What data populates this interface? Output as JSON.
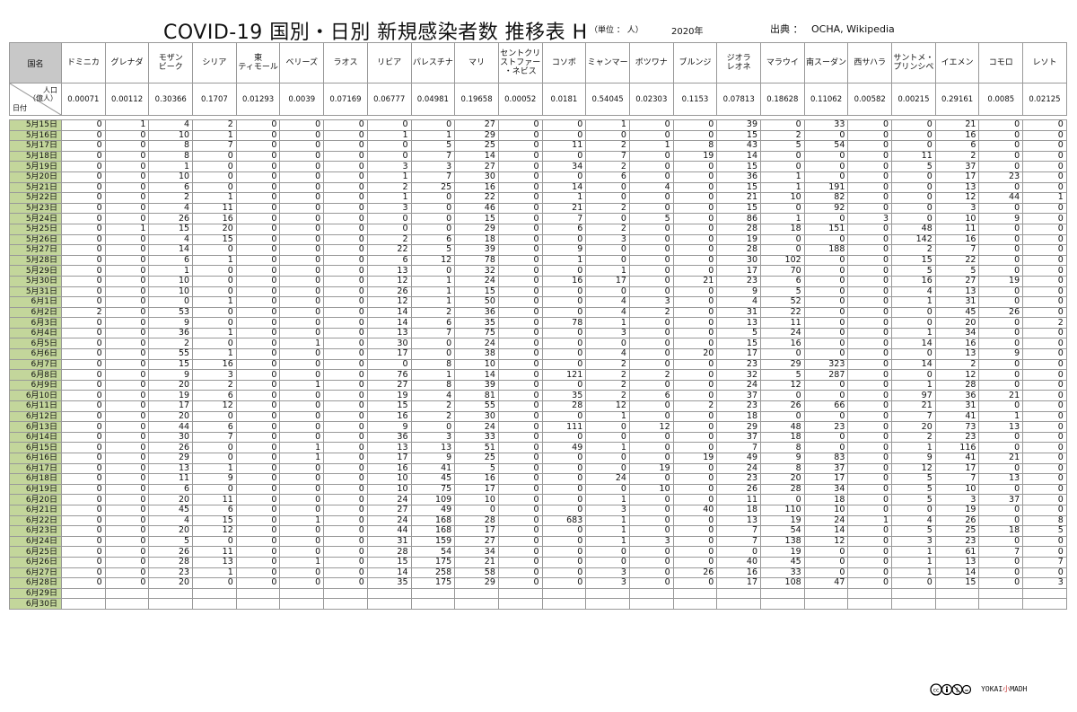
{
  "header": {
    "title": "COVID-19  国別・日別  新規感染者数  推移表  H",
    "unit": "（単位 ： 人）",
    "year": "2020年",
    "source_label": "出典 ：",
    "sources": "OCHA,  Wikipedia"
  },
  "table": {
    "country_label": "国名",
    "population_label": "人口\n（億人）",
    "date_label": "日付",
    "countries": [
      "ドミニカ",
      "グレナダ",
      "モザン\nビーク",
      "シリア",
      "東\nティモール",
      "ベリーズ",
      "ラオス",
      "リビア",
      "パレスチナ",
      "マリ",
      "セントクリ\nストファー\n・ネビス",
      "コソボ",
      "ミャンマー",
      "ボツワナ",
      "ブルンジ",
      "ジオラ\nレオネ",
      "マラウイ",
      "南スーダン",
      "西サハラ",
      "サントメ・\nプリンシペ",
      "イエメン",
      "コモロ",
      "レソト"
    ],
    "population": [
      "0.00071",
      "0.00112",
      "0.30366",
      "0.1707",
      "0.01293",
      "0.0039",
      "0.07169",
      "0.06777",
      "0.04981",
      "0.19658",
      "0.00052",
      "0.0181",
      "0.54045",
      "0.02303",
      "0.1153",
      "0.07813",
      "0.18628",
      "0.11062",
      "0.00582",
      "0.00215",
      "0.29161",
      "0.0085",
      "0.02125"
    ],
    "rows": [
      {
        "date": "5月15日",
        "v": [
          0,
          1,
          4,
          2,
          0,
          0,
          0,
          0,
          0,
          27,
          0,
          0,
          1,
          0,
          0,
          39,
          0,
          33,
          0,
          0,
          21,
          0,
          0
        ]
      },
      {
        "date": "5月16日",
        "v": [
          0,
          0,
          10,
          1,
          0,
          0,
          0,
          1,
          1,
          29,
          0,
          0,
          0,
          0,
          0,
          15,
          2,
          0,
          0,
          0,
          16,
          0,
          0
        ]
      },
      {
        "date": "5月17日",
        "v": [
          0,
          0,
          8,
          7,
          0,
          0,
          0,
          0,
          5,
          25,
          0,
          11,
          2,
          1,
          8,
          43,
          5,
          54,
          0,
          0,
          6,
          0,
          0
        ]
      },
      {
        "date": "5月18日",
        "v": [
          0,
          0,
          8,
          0,
          0,
          0,
          0,
          0,
          7,
          14,
          0,
          0,
          7,
          0,
          19,
          14,
          0,
          0,
          0,
          11,
          2,
          0,
          0
        ]
      },
      {
        "date": "5月19日",
        "v": [
          0,
          0,
          1,
          0,
          0,
          0,
          0,
          3,
          3,
          27,
          0,
          34,
          2,
          0,
          0,
          15,
          0,
          0,
          0,
          5,
          37,
          0,
          0
        ]
      },
      {
        "date": "5月20日",
        "v": [
          0,
          0,
          10,
          0,
          0,
          0,
          0,
          1,
          7,
          30,
          0,
          0,
          6,
          0,
          0,
          36,
          1,
          0,
          0,
          0,
          17,
          23,
          0
        ]
      },
      {
        "date": "5月21日",
        "v": [
          0,
          0,
          6,
          0,
          0,
          0,
          0,
          2,
          25,
          16,
          0,
          14,
          0,
          4,
          0,
          15,
          1,
          191,
          0,
          0,
          13,
          0,
          0
        ]
      },
      {
        "date": "5月22日",
        "v": [
          0,
          0,
          2,
          1,
          0,
          0,
          0,
          1,
          0,
          22,
          0,
          1,
          0,
          0,
          0,
          21,
          10,
          82,
          0,
          0,
          12,
          44,
          1
        ]
      },
      {
        "date": "5月23日",
        "v": [
          0,
          0,
          4,
          11,
          0,
          0,
          0,
          3,
          0,
          46,
          0,
          21,
          2,
          0,
          0,
          15,
          0,
          92,
          0,
          0,
          3,
          0,
          0
        ]
      },
      {
        "date": "5月24日",
        "v": [
          0,
          0,
          26,
          16,
          0,
          0,
          0,
          0,
          0,
          15,
          0,
          7,
          0,
          5,
          0,
          86,
          1,
          0,
          3,
          0,
          10,
          9,
          0
        ]
      },
      {
        "date": "5月25日",
        "v": [
          0,
          1,
          15,
          20,
          0,
          0,
          0,
          0,
          0,
          29,
          0,
          6,
          2,
          0,
          0,
          28,
          18,
          151,
          0,
          48,
          11,
          0,
          0
        ]
      },
      {
        "date": "5月26日",
        "v": [
          0,
          0,
          4,
          15,
          0,
          0,
          0,
          2,
          6,
          18,
          0,
          0,
          3,
          0,
          0,
          19,
          0,
          0,
          0,
          142,
          16,
          0,
          0
        ]
      },
      {
        "date": "5月27日",
        "v": [
          0,
          0,
          14,
          0,
          0,
          0,
          0,
          22,
          5,
          39,
          0,
          9,
          0,
          0,
          0,
          28,
          0,
          188,
          0,
          2,
          7,
          0,
          0
        ]
      },
      {
        "date": "5月28日",
        "v": [
          0,
          0,
          6,
          1,
          0,
          0,
          0,
          6,
          12,
          78,
          0,
          1,
          0,
          0,
          0,
          30,
          102,
          0,
          0,
          15,
          22,
          0,
          0
        ]
      },
      {
        "date": "5月29日",
        "v": [
          0,
          0,
          1,
          0,
          0,
          0,
          0,
          13,
          0,
          32,
          0,
          0,
          1,
          0,
          0,
          17,
          70,
          0,
          0,
          5,
          5,
          0,
          0
        ]
      },
      {
        "date": "5月30日",
        "v": [
          0,
          0,
          10,
          0,
          0,
          0,
          0,
          12,
          1,
          24,
          0,
          16,
          17,
          0,
          21,
          23,
          6,
          0,
          0,
          16,
          27,
          19,
          0
        ]
      },
      {
        "date": "5月31日",
        "v": [
          0,
          0,
          10,
          0,
          0,
          0,
          0,
          26,
          1,
          15,
          0,
          0,
          0,
          0,
          0,
          9,
          5,
          0,
          0,
          4,
          13,
          0,
          0
        ]
      },
      {
        "date": "6月1日",
        "v": [
          0,
          0,
          0,
          1,
          0,
          0,
          0,
          12,
          1,
          50,
          0,
          0,
          4,
          3,
          0,
          4,
          52,
          0,
          0,
          1,
          31,
          0,
          0
        ]
      },
      {
        "date": "6月2日",
        "v": [
          2,
          0,
          53,
          0,
          0,
          0,
          0,
          14,
          2,
          36,
          0,
          0,
          4,
          2,
          0,
          31,
          22,
          0,
          0,
          0,
          45,
          26,
          0
        ]
      },
      {
        "date": "6月3日",
        "v": [
          0,
          0,
          9,
          0,
          0,
          0,
          0,
          14,
          6,
          35,
          0,
          78,
          1,
          0,
          0,
          13,
          11,
          0,
          0,
          0,
          20,
          0,
          2
        ]
      },
      {
        "date": "6月4日",
        "v": [
          0,
          0,
          36,
          1,
          0,
          0,
          0,
          13,
          7,
          75,
          0,
          0,
          3,
          0,
          0,
          5,
          24,
          0,
          0,
          1,
          34,
          0,
          0
        ]
      },
      {
        "date": "6月5日",
        "v": [
          0,
          0,
          2,
          0,
          0,
          1,
          0,
          30,
          0,
          24,
          0,
          0,
          0,
          0,
          0,
          15,
          16,
          0,
          0,
          14,
          16,
          0,
          0
        ]
      },
      {
        "date": "6月6日",
        "v": [
          0,
          0,
          55,
          1,
          0,
          0,
          0,
          17,
          0,
          38,
          0,
          0,
          4,
          0,
          20,
          17,
          0,
          0,
          0,
          0,
          13,
          9,
          0
        ]
      },
      {
        "date": "6月7日",
        "v": [
          0,
          0,
          15,
          16,
          0,
          0,
          0,
          0,
          8,
          10,
          0,
          0,
          2,
          0,
          0,
          23,
          29,
          323,
          0,
          14,
          2,
          0,
          0
        ]
      },
      {
        "date": "6月8日",
        "v": [
          0,
          0,
          9,
          3,
          0,
          0,
          0,
          76,
          1,
          14,
          0,
          121,
          2,
          2,
          0,
          32,
          5,
          287,
          0,
          0,
          12,
          0,
          0
        ]
      },
      {
        "date": "6月9日",
        "v": [
          0,
          0,
          20,
          2,
          0,
          1,
          0,
          27,
          8,
          39,
          0,
          0,
          2,
          0,
          0,
          24,
          12,
          0,
          0,
          1,
          28,
          0,
          0
        ]
      },
      {
        "date": "6月10日",
        "v": [
          0,
          0,
          19,
          6,
          0,
          0,
          0,
          19,
          4,
          81,
          0,
          35,
          2,
          6,
          0,
          37,
          0,
          0,
          0,
          97,
          36,
          21,
          0
        ]
      },
      {
        "date": "6月11日",
        "v": [
          0,
          0,
          17,
          12,
          0,
          0,
          0,
          15,
          2,
          55,
          0,
          28,
          12,
          0,
          2,
          23,
          26,
          66,
          0,
          21,
          31,
          0,
          0
        ]
      },
      {
        "date": "6月12日",
        "v": [
          0,
          0,
          20,
          0,
          0,
          0,
          0,
          16,
          2,
          30,
          0,
          0,
          1,
          0,
          0,
          18,
          0,
          0,
          0,
          7,
          41,
          1,
          0
        ]
      },
      {
        "date": "6月13日",
        "v": [
          0,
          0,
          44,
          6,
          0,
          0,
          0,
          9,
          0,
          24,
          0,
          111,
          0,
          12,
          0,
          29,
          48,
          23,
          0,
          20,
          73,
          13,
          0
        ]
      },
      {
        "date": "6月14日",
        "v": [
          0,
          0,
          30,
          7,
          0,
          0,
          0,
          36,
          3,
          33,
          0,
          0,
          0,
          0,
          0,
          37,
          18,
          0,
          0,
          2,
          23,
          0,
          0
        ]
      },
      {
        "date": "6月15日",
        "v": [
          0,
          0,
          26,
          0,
          0,
          1,
          0,
          13,
          13,
          51,
          0,
          49,
          1,
          0,
          0,
          7,
          8,
          0,
          0,
          1,
          116,
          0,
          0
        ]
      },
      {
        "date": "6月16日",
        "v": [
          0,
          0,
          29,
          0,
          0,
          1,
          0,
          17,
          9,
          25,
          0,
          0,
          0,
          0,
          19,
          49,
          9,
          83,
          0,
          9,
          41,
          21,
          0
        ]
      },
      {
        "date": "6月17日",
        "v": [
          0,
          0,
          13,
          1,
          0,
          0,
          0,
          16,
          41,
          5,
          0,
          0,
          0,
          19,
          0,
          24,
          8,
          37,
          0,
          12,
          17,
          0,
          0
        ]
      },
      {
        "date": "6月18日",
        "v": [
          0,
          0,
          11,
          9,
          0,
          0,
          0,
          10,
          45,
          16,
          0,
          0,
          24,
          0,
          0,
          23,
          20,
          17,
          0,
          5,
          7,
          13,
          0
        ]
      },
      {
        "date": "6月19日",
        "v": [
          0,
          0,
          6,
          0,
          0,
          0,
          0,
          10,
          75,
          17,
          0,
          0,
          0,
          10,
          0,
          26,
          28,
          34,
          0,
          5,
          10,
          0,
          0
        ]
      },
      {
        "date": "6月20日",
        "v": [
          0,
          0,
          20,
          11,
          0,
          0,
          0,
          24,
          109,
          10,
          0,
          0,
          1,
          0,
          0,
          11,
          0,
          18,
          0,
          5,
          3,
          37,
          0
        ]
      },
      {
        "date": "6月21日",
        "v": [
          0,
          0,
          45,
          6,
          0,
          0,
          0,
          27,
          49,
          0,
          0,
          0,
          3,
          0,
          40,
          18,
          110,
          10,
          0,
          0,
          19,
          0,
          0
        ]
      },
      {
        "date": "6月22日",
        "v": [
          0,
          0,
          4,
          15,
          0,
          1,
          0,
          24,
          168,
          28,
          0,
          683,
          1,
          0,
          0,
          13,
          19,
          24,
          1,
          4,
          26,
          0,
          8
        ]
      },
      {
        "date": "6月23日",
        "v": [
          0,
          0,
          20,
          12,
          0,
          0,
          0,
          44,
          168,
          17,
          0,
          0,
          1,
          0,
          0,
          7,
          54,
          14,
          0,
          5,
          25,
          18,
          5
        ]
      },
      {
        "date": "6月24日",
        "v": [
          0,
          0,
          5,
          0,
          0,
          0,
          0,
          31,
          159,
          27,
          0,
          0,
          1,
          3,
          0,
          7,
          138,
          12,
          0,
          3,
          23,
          0,
          0
        ]
      },
      {
        "date": "6月25日",
        "v": [
          0,
          0,
          26,
          11,
          0,
          0,
          0,
          28,
          54,
          34,
          0,
          0,
          0,
          0,
          0,
          0,
          19,
          0,
          0,
          1,
          61,
          7,
          0
        ]
      },
      {
        "date": "6月26日",
        "v": [
          0,
          0,
          28,
          13,
          0,
          1,
          0,
          15,
          175,
          21,
          0,
          0,
          0,
          0,
          0,
          40,
          45,
          0,
          0,
          1,
          13,
          0,
          7
        ]
      },
      {
        "date": "6月27日",
        "v": [
          0,
          0,
          23,
          1,
          0,
          0,
          0,
          14,
          258,
          58,
          0,
          0,
          3,
          0,
          26,
          16,
          33,
          0,
          0,
          1,
          14,
          0,
          0
        ]
      },
      {
        "date": "6月28日",
        "v": [
          0,
          0,
          20,
          0,
          0,
          0,
          0,
          35,
          175,
          29,
          0,
          0,
          3,
          0,
          0,
          17,
          108,
          47,
          0,
          0,
          15,
          0,
          3
        ]
      },
      {
        "date": "6月29日",
        "v": []
      },
      {
        "date": "6月30日",
        "v": []
      }
    ]
  },
  "footer": {
    "license": "cc by nc sa",
    "brand_left": "YOKAI",
    "brand_mid": "小",
    "brand_right": "MADH"
  }
}
